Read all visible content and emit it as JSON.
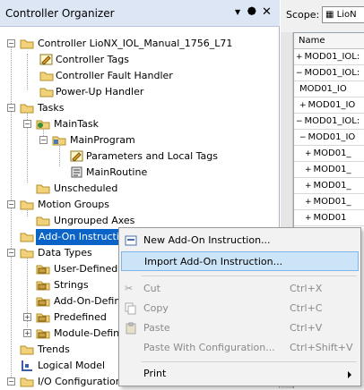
{
  "organizer": {
    "title": "Controller Organizer",
    "tree": [
      "Controller LioNX_IOL_Manual_1756_L71",
      "Controller Tags",
      "Controller Fault Handler",
      "Power-Up Handler",
      "Tasks",
      "MainTask",
      "MainProgram",
      "Parameters and Local Tags",
      "MainRoutine",
      "Unscheduled",
      "Motion Groups",
      "Ungrouped Axes",
      "Add-On Instructions",
      "Data Types",
      "User-Defined",
      "Strings",
      "Add-On-Defined",
      "Predefined",
      "Module-Defined",
      "Trends",
      "Logical Model",
      "I/O Configuration"
    ]
  },
  "grid": {
    "scope_label": "Scope:",
    "scope_value": "LioN",
    "column_name": "Name",
    "rows": [
      {
        "sign": "+",
        "text": "MOD01_IOL:"
      },
      {
        "sign": "−",
        "text": "MOD01_IOL:"
      },
      {
        "sign": "",
        "text": "MOD01_IO"
      },
      {
        "sign": "+",
        "text": "MOD01_IO"
      },
      {
        "sign": "−",
        "text": "MOD01_IOL:"
      },
      {
        "sign": "−",
        "text": "MOD01_IO"
      },
      {
        "sign": "+",
        "text": "MOD01_"
      },
      {
        "sign": "+",
        "text": "MOD01_"
      },
      {
        "sign": "+",
        "text": "MOD01_"
      },
      {
        "sign": "+",
        "text": "MOD01_"
      },
      {
        "sign": "+",
        "text": "MOD01"
      }
    ]
  },
  "context_menu": {
    "new_aoi": "New Add-On Instruction...",
    "import_aoi": "Import Add-On Instruction...",
    "cut": "Cut",
    "cut_shortcut": "Ctrl+X",
    "copy": "Copy",
    "copy_shortcut": "Ctrl+C",
    "paste": "Paste",
    "paste_shortcut": "Ctrl+V",
    "paste_with_config": "Paste With Configuration...",
    "paste_with_config_shortcut": "Ctrl+Shift+V",
    "print": "Print"
  }
}
